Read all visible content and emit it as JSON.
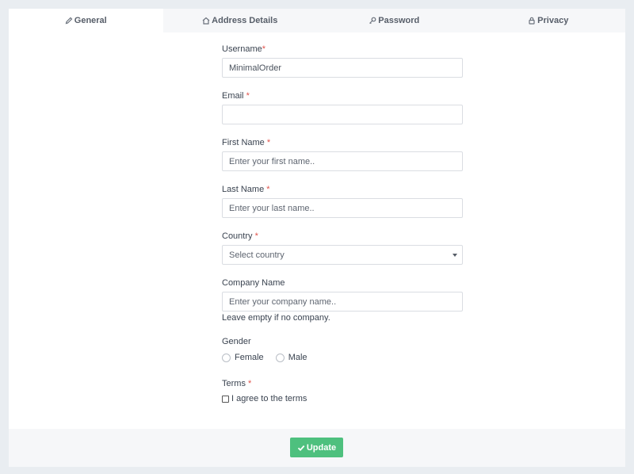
{
  "tabs": [
    {
      "label": "General",
      "icon": "pencil-icon",
      "active": true
    },
    {
      "label": "Address Details",
      "icon": "home-icon",
      "active": false
    },
    {
      "label": "Password",
      "icon": "key-icon",
      "active": false
    },
    {
      "label": "Privacy",
      "icon": "lock-icon",
      "active": false
    }
  ],
  "form": {
    "username": {
      "label": "Username",
      "required_mark": "*",
      "value": "MinimalOrder"
    },
    "email": {
      "label": "Email",
      "required_mark": "*",
      "value": ""
    },
    "first_name": {
      "label": "First Name",
      "required_mark": "*",
      "placeholder": "Enter your first name.."
    },
    "last_name": {
      "label": "Last Name",
      "required_mark": "*",
      "placeholder": "Enter your last name.."
    },
    "country": {
      "label": "Country",
      "required_mark": "*",
      "selected": "Select country"
    },
    "company": {
      "label": "Company Name",
      "placeholder": "Enter your company name..",
      "help": "Leave empty if no company."
    },
    "gender": {
      "label": "Gender",
      "options": [
        "Female",
        "Male"
      ]
    },
    "terms": {
      "label": "Terms",
      "required_mark": "*",
      "checkbox_label": "I agree to the terms"
    }
  },
  "footer": {
    "update_label": "Update"
  },
  "colors": {
    "accent_green": "#4ec07e",
    "required_red": "#e0534b"
  }
}
